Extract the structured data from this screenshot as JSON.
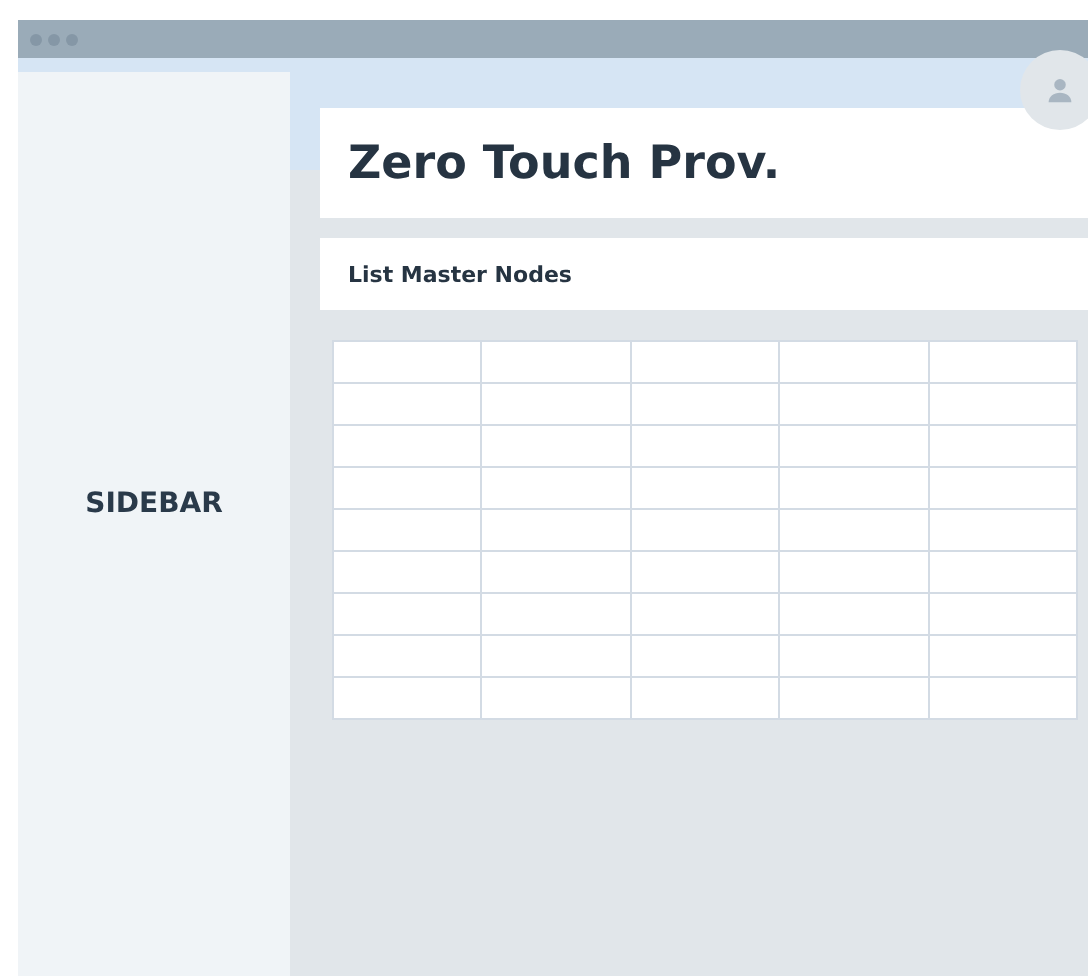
{
  "sidebar": {
    "label": "SIDEBAR"
  },
  "header": {
    "title": "Zero Touch Prov."
  },
  "section": {
    "title": "List Master Nodes"
  }
}
